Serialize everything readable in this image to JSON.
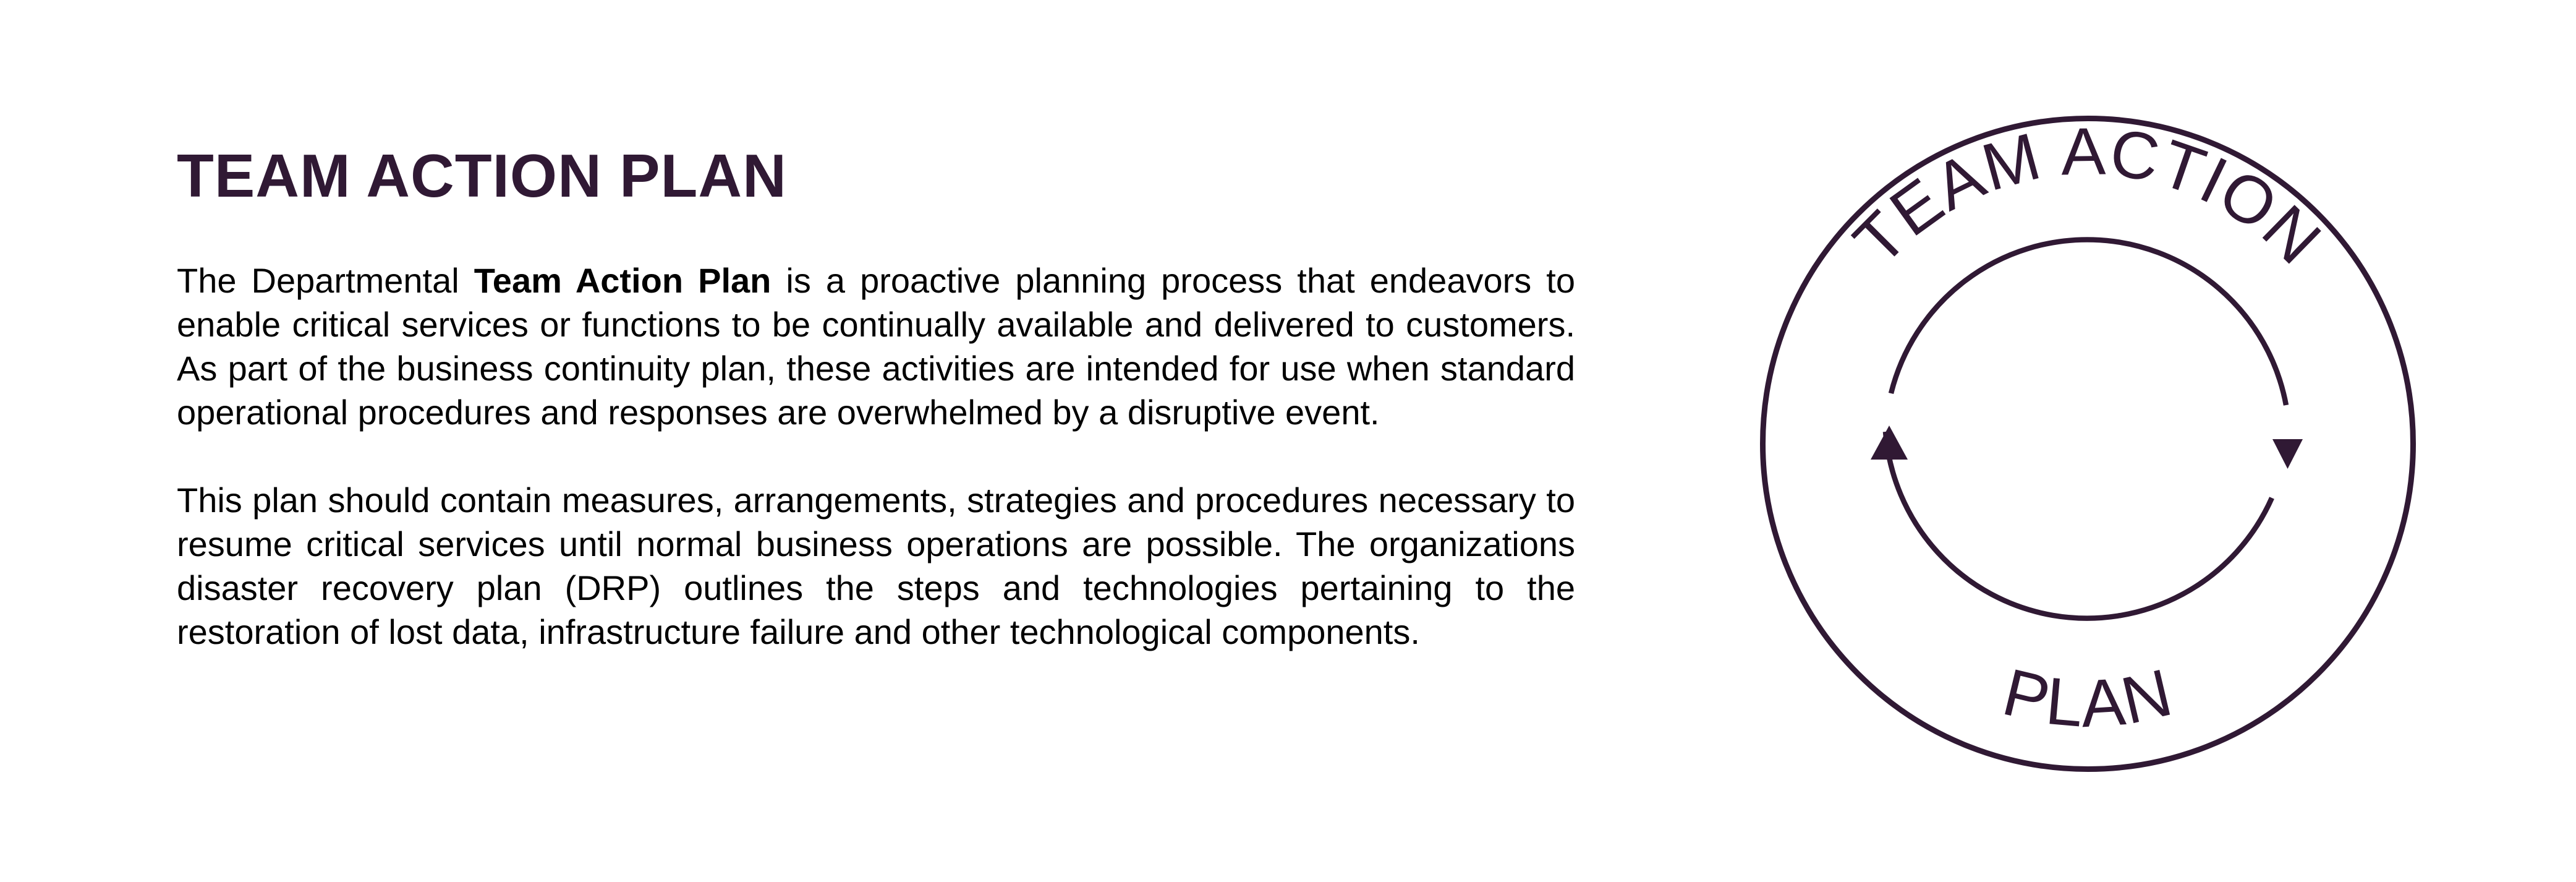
{
  "heading": "TEAM ACTION PLAN",
  "paragraph1": {
    "lead": "The Departmental ",
    "emphasis": "Team Action Plan",
    "rest": " is a proactive planning process that endeavors to enable critical services or functions to be continually available and delivered to customers. As part of the business continuity plan, these activities are intended for use when standard operational procedures and responses are overwhelmed by a disruptive event."
  },
  "paragraph2": "This plan should contain measures, arrangements, strategies and procedures necessary to resume critical services until normal business operations are possible. The organizations disaster recovery plan (DRP) outlines the steps and technologies pertaining to the restoration of lost data, infrastructure failure and other technological components.",
  "cycle_diagram": {
    "top_label": "TEAM ACTION",
    "bottom_label": "PLAN",
    "color": "#301934",
    "icon": "circular-arrows-icon"
  }
}
